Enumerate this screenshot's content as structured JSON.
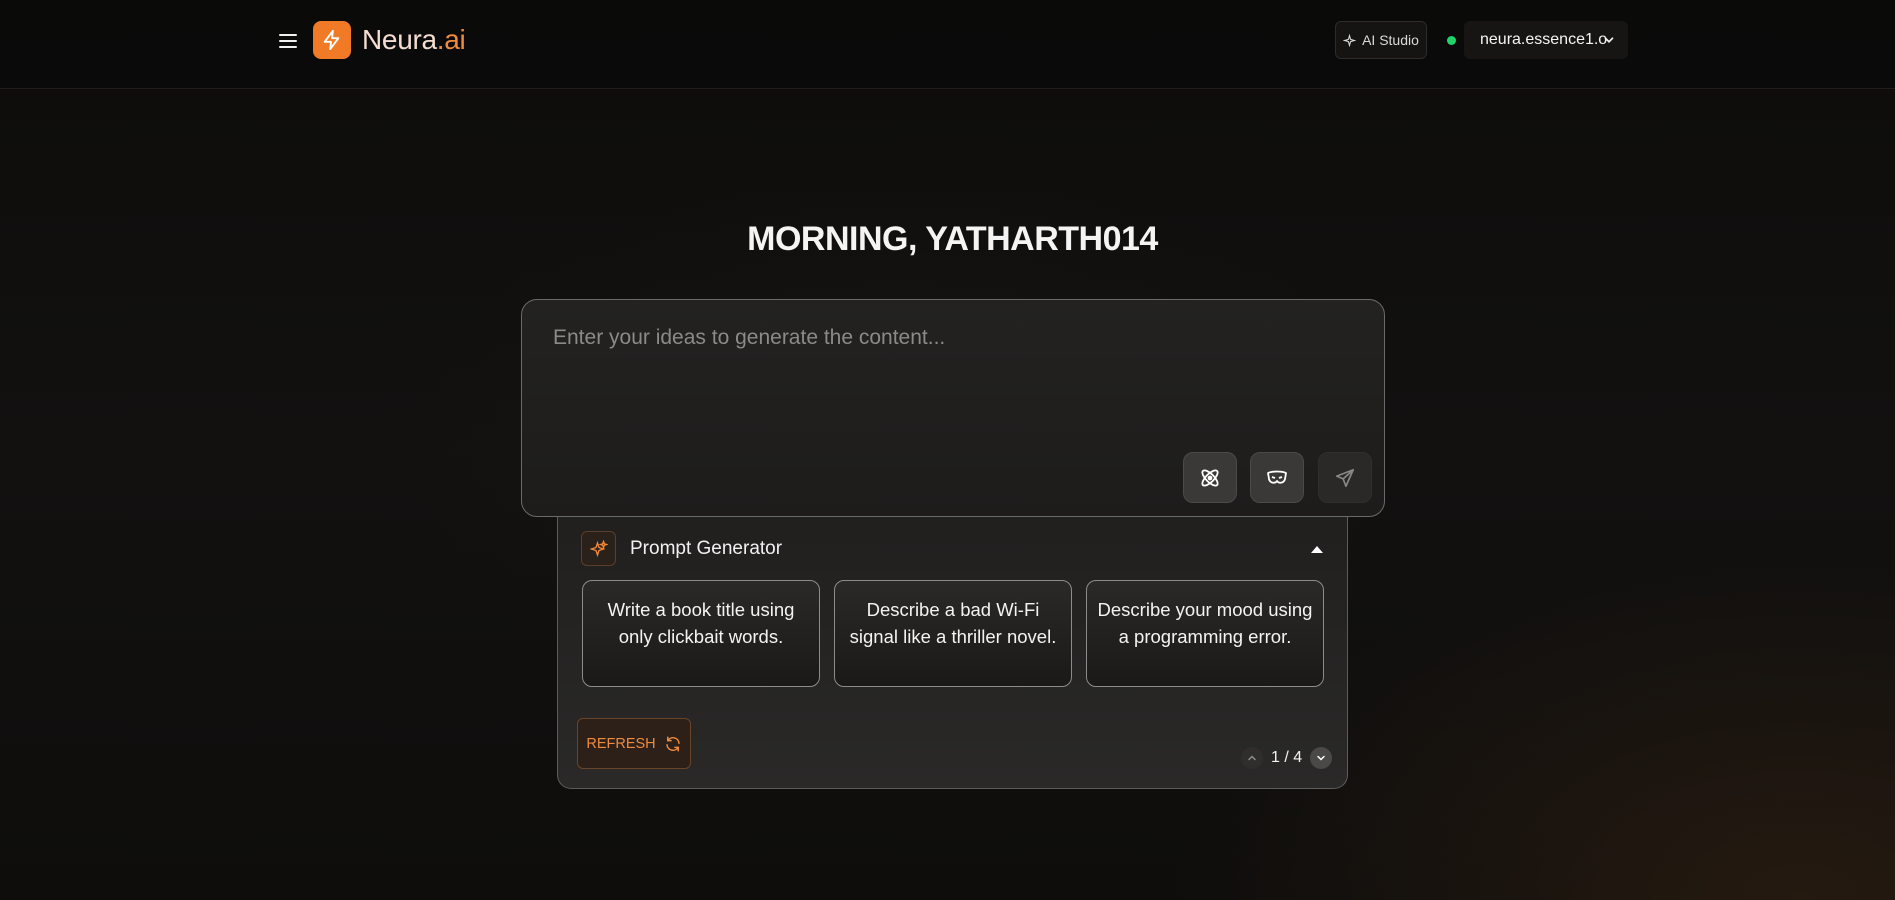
{
  "header": {
    "brand_part1": "Neura",
    "brand_part2": ".ai",
    "studio_label": "AI Studio",
    "model_name": "neura.essence1.o"
  },
  "main": {
    "greeting": "MORNING, YATHARTH014",
    "prompt_placeholder": "Enter your ideas to generate the content...",
    "prompt_value": ""
  },
  "generator": {
    "title": "Prompt Generator",
    "cards": [
      "Write a book title using only clickbait words.",
      "Describe a bad Wi-Fi signal like a thriller novel.",
      "Describe your mood using a programming error."
    ],
    "refresh_label": "REFRESH",
    "page_text": "1 / 4"
  },
  "colors": {
    "accent": "#f07a26",
    "status": "#1fd36a",
    "background": "#0f0e0d"
  },
  "icons": [
    "menu-icon",
    "bolt-icon",
    "sparkle-icon",
    "chevron-down-icon",
    "atom-icon",
    "mask-icon",
    "send-icon",
    "triangle-up-icon",
    "refresh-icon",
    "chevron-up-icon"
  ]
}
